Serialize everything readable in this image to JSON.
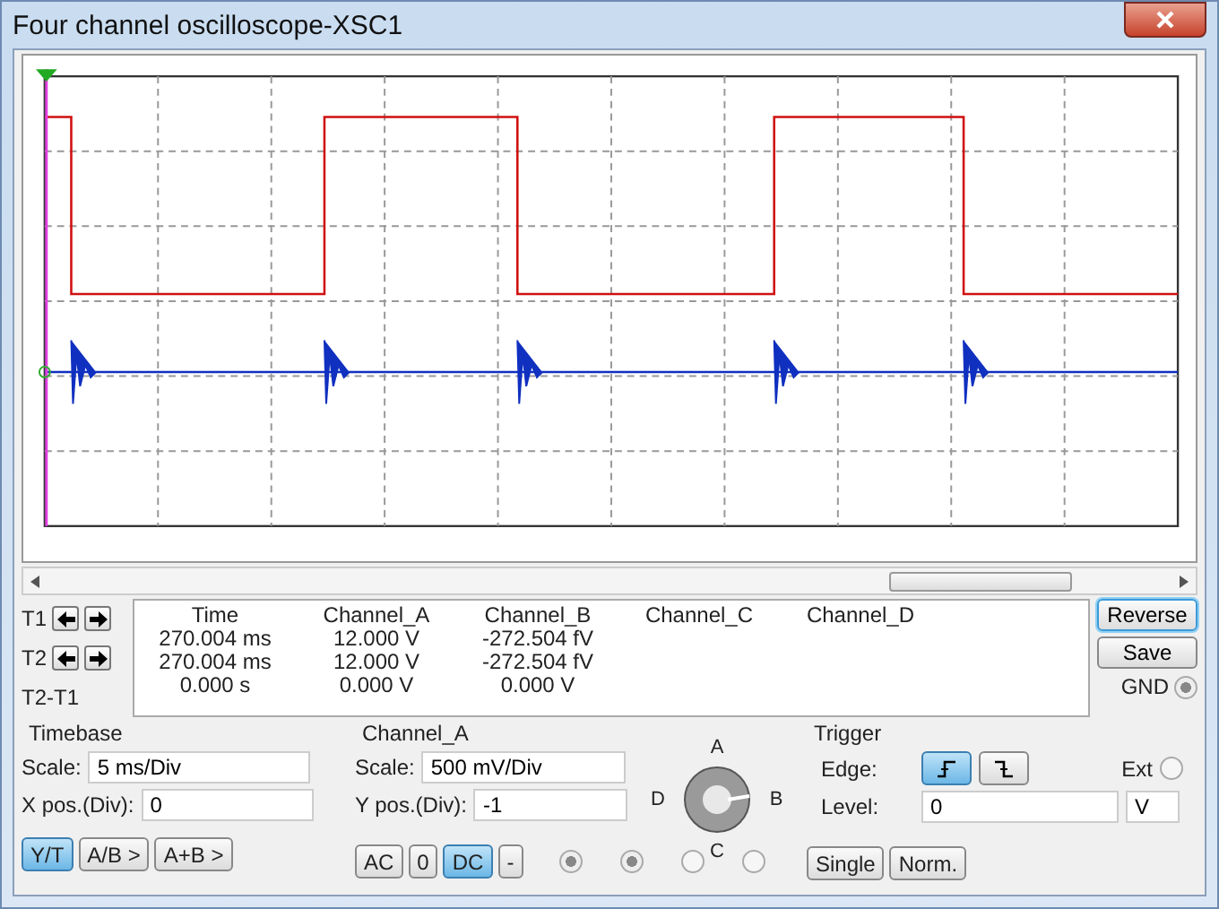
{
  "window": {
    "title": "Four channel oscilloscope-XSC1"
  },
  "cursors": [
    {
      "label": "T1"
    },
    {
      "label": "T2"
    }
  ],
  "difference_label": "T2-T1",
  "readout": {
    "columns": [
      "Time",
      "Channel_A",
      "Channel_B",
      "Channel_C",
      "Channel_D"
    ],
    "rows": [
      [
        "270.004 ms",
        "12.000 V",
        "-272.504 fV"
      ],
      [
        "270.004 ms",
        "12.000 V",
        "-272.504 fV"
      ],
      [
        "0.000 s",
        "0.000 V",
        "0.000 V"
      ]
    ]
  },
  "side_buttons": [
    {
      "label": "Reverse",
      "focused": true
    },
    {
      "label": "Save",
      "focused": false
    }
  ],
  "gnd": {
    "label": "GND",
    "on": true
  },
  "timebase": {
    "title": "Timebase",
    "fields": [
      {
        "label": "Scale:",
        "value": "5 ms/Div"
      },
      {
        "label": "X pos.(Div):",
        "value": "0"
      }
    ],
    "modes": [
      {
        "label": "Y/T",
        "selected": true
      },
      {
        "label": "A/B >",
        "selected": false
      },
      {
        "label": "A+B >",
        "selected": false
      }
    ]
  },
  "channel": {
    "title": "Channel_A",
    "fields": [
      {
        "label": "Scale:",
        "value": "500 mV/Div"
      },
      {
        "label": "Y pos.(Div):",
        "value": "-1"
      }
    ],
    "coupling": [
      {
        "label": "AC",
        "selected": false
      },
      {
        "label": "0",
        "selected": false
      },
      {
        "label": "DC",
        "selected": true
      },
      {
        "label": "-",
        "selected": false
      }
    ],
    "indicators": [
      {
        "on": true
      },
      {
        "on": true
      },
      {
        "on": false
      },
      {
        "on": false
      }
    ]
  },
  "knob": {
    "labels": [
      "A",
      "B",
      "C",
      "D"
    ]
  },
  "trigger": {
    "title": "Trigger",
    "edge_label": "Edge:",
    "edges": [
      {
        "kind": "rising",
        "selected": true
      },
      {
        "kind": "falling",
        "selected": false
      }
    ],
    "ext": {
      "label": "Ext",
      "on": false
    },
    "level": {
      "label": "Level:",
      "value": "0",
      "unit": "V"
    },
    "modes": [
      {
        "label": "Single",
        "selected": false
      },
      {
        "label": "Norm.",
        "selected": false
      }
    ]
  }
}
